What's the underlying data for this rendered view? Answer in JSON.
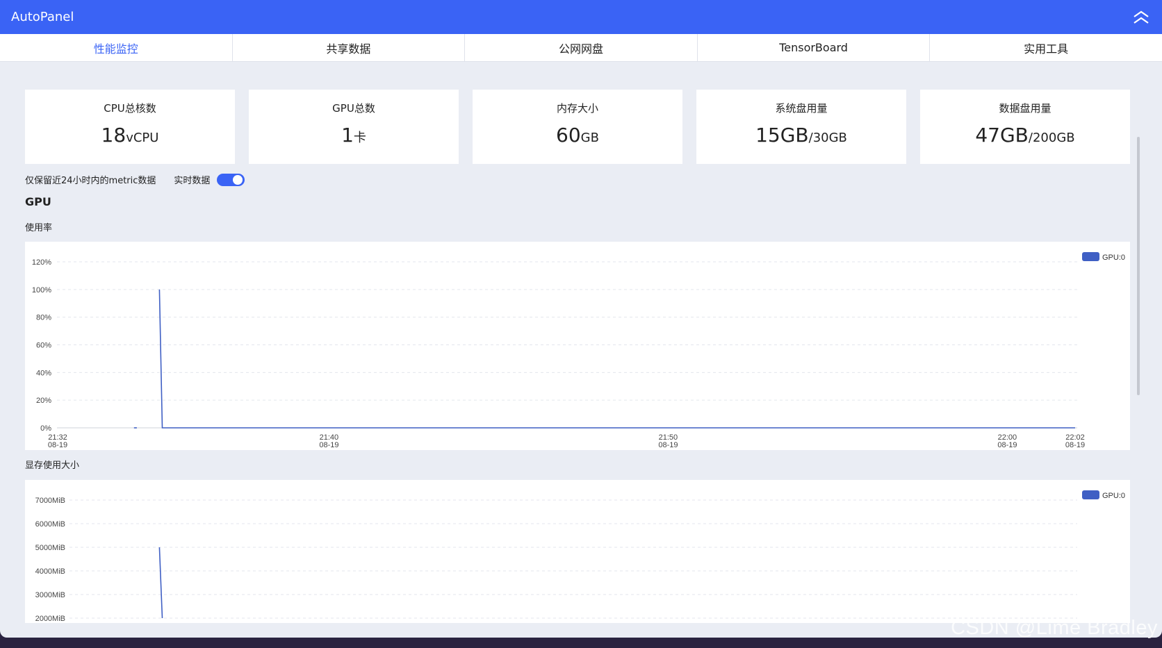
{
  "app": {
    "title": "AutoPanel"
  },
  "tabs": [
    {
      "label": "性能监控",
      "active": true
    },
    {
      "label": "共享数据",
      "active": false
    },
    {
      "label": "公网网盘",
      "active": false
    },
    {
      "label": "TensorBoard",
      "active": false
    },
    {
      "label": "实用工具",
      "active": false
    }
  ],
  "cards": [
    {
      "label": "CPU总核数",
      "value": "18",
      "unit": "vCPU"
    },
    {
      "label": "GPU总数",
      "value": "1",
      "unit": "卡"
    },
    {
      "label": "内存大小",
      "value": "60",
      "unit": "GB"
    },
    {
      "label": "系统盘用量",
      "value": "15GB",
      "unit": "/30GB"
    },
    {
      "label": "数据盘用量",
      "value": "47GB",
      "unit": "/200GB"
    }
  ],
  "retention_note": "仅保留近24小时内的metric数据",
  "realtime": {
    "label": "实时数据",
    "enabled": true
  },
  "section": {
    "title": "GPU"
  },
  "usage_chart": {
    "title": "使用率"
  },
  "memory_chart": {
    "title": "显存使用大小"
  },
  "colors": {
    "accent": "#3a63f5",
    "series": "#3f5fc4"
  },
  "chart_data": [
    {
      "type": "line",
      "title": "",
      "ylabel": "",
      "ylim": [
        0,
        120
      ],
      "yticks": [
        "0%",
        "20%",
        "40%",
        "60%",
        "80%",
        "100%",
        "120%"
      ],
      "xticks": [
        {
          "time": "21:32",
          "date": "08-19"
        },
        {
          "time": "21:40",
          "date": "08-19"
        },
        {
          "time": "21:50",
          "date": "08-19"
        },
        {
          "time": "22:00",
          "date": "08-19"
        },
        {
          "time": "22:02",
          "date": "08-19"
        }
      ],
      "legend": "top-right",
      "series": [
        {
          "name": "GPU:0",
          "segments": [
            [
              [
                "21:34:15",
                0
              ],
              [
                "21:34:20",
                0
              ]
            ],
            [
              [
                "21:35:00",
                100
              ],
              [
                "21:35:05",
                0
              ],
              [
                "22:02:00",
                0
              ]
            ]
          ]
        }
      ]
    },
    {
      "type": "line",
      "title": "",
      "ylabel": "",
      "ylim": [
        2000,
        7000
      ],
      "yticks": [
        "2000MiB",
        "3000MiB",
        "4000MiB",
        "5000MiB",
        "6000MiB",
        "7000MiB"
      ],
      "legend": "top-right",
      "series": [
        {
          "name": "GPU:0",
          "segments": [
            [
              [
                "21:35:00",
                5000
              ],
              [
                "21:35:05",
                2000
              ]
            ]
          ]
        }
      ]
    }
  ]
}
